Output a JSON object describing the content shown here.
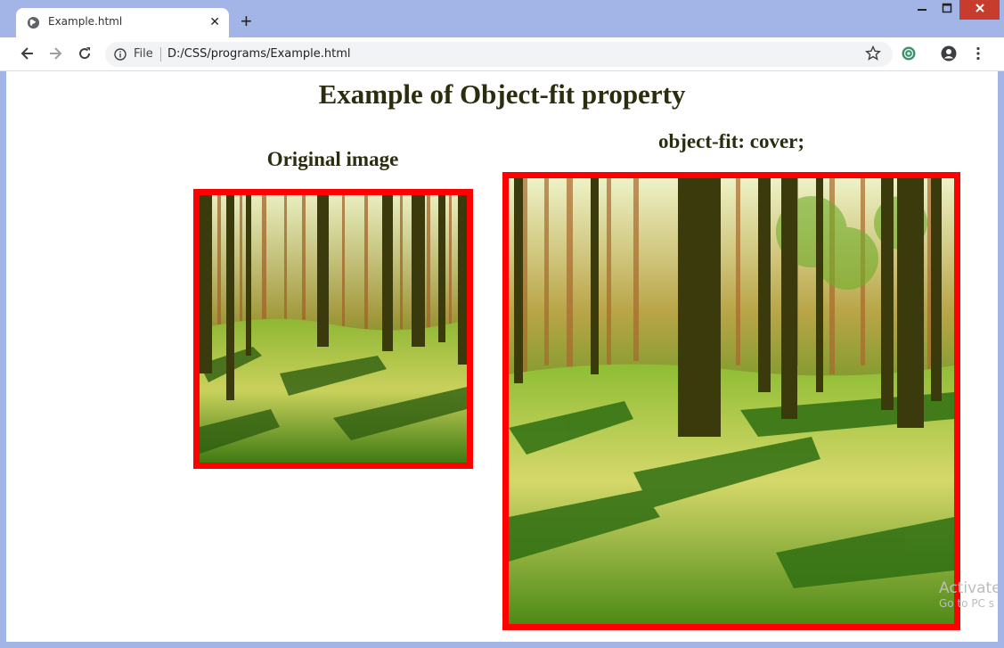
{
  "browser": {
    "tab_title": "Example.html",
    "tab_close_glyph": "✕",
    "new_tab_glyph": "+",
    "window_minimize_glyph": "—",
    "window_maximize_glyph": "☐",
    "window_close_glyph": "✕",
    "url_scheme_label": "File",
    "url": "D:/CSS/programs/Example.html",
    "icons": [
      "globe-icon",
      "back-arrow-icon",
      "forward-arrow-icon",
      "reload-icon",
      "info-icon",
      "star-icon",
      "extension-icon",
      "account-icon",
      "menu-icon"
    ]
  },
  "page": {
    "heading": "Example of Object-fit property",
    "original_caption": "Original image",
    "cover_caption": "object-fit: cover;",
    "image_subject": "forest-image",
    "border_color": "#ff0000",
    "heading_color": "#2b2d0e"
  },
  "watermark": {
    "line1": "Activate",
    "line2": "Go to PC s"
  },
  "colors": {
    "chrome_background": "#a3b4e6",
    "window_close_red": "#c83c2d"
  }
}
